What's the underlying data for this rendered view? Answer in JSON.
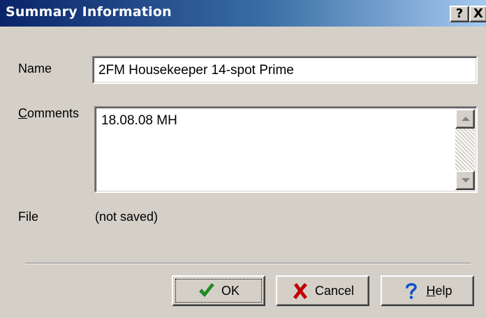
{
  "window": {
    "title": "Summary Information",
    "help_button": "?",
    "close_button": "X"
  },
  "form": {
    "name_label": "Name",
    "name_value": "2FM Housekeeper 14-spot Prime",
    "comments_label_accel": "C",
    "comments_label_rest": "omments",
    "comments_value": "18.08.08 MH",
    "file_label": "File",
    "file_value": "(not saved)"
  },
  "buttons": {
    "ok_label": "OK",
    "cancel_label": "Cancel",
    "help_label_accel": "H",
    "help_label_rest": "elp",
    "ok_icon": "check-icon",
    "cancel_icon": "x-icon",
    "help_icon": "question-icon"
  },
  "colors": {
    "titlebar_start": "#0a246a",
    "titlebar_end": "#a6caf0",
    "face": "#d4d0c8",
    "check_green": "#1f9a1f",
    "cancel_red": "#c00000",
    "help_blue": "#1050c8"
  }
}
